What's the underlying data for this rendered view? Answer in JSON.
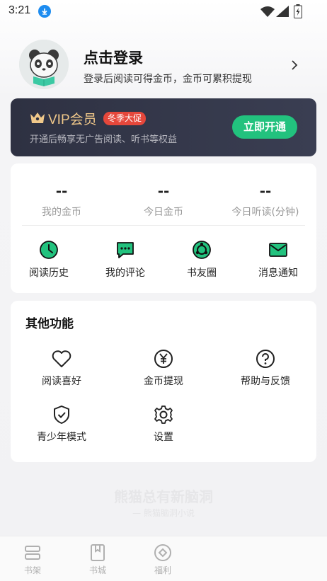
{
  "status_bar": {
    "time": "3:21"
  },
  "profile": {
    "title": "点击登录",
    "subtitle": "登录后阅读可得金币，金币可累积提现"
  },
  "vip": {
    "title": "VIP会员",
    "badge": "冬季大促",
    "description": "开通后畅享无广告阅读、听书等权益",
    "button": "立即开通",
    "accent_color": "#22c27e"
  },
  "stats": [
    {
      "value": "--",
      "label": "我的金币"
    },
    {
      "value": "--",
      "label": "今日金币"
    },
    {
      "value": "--",
      "label": "今日听读(分钟)"
    }
  ],
  "quick_actions": [
    {
      "icon": "clock-icon",
      "label": "阅读历史"
    },
    {
      "icon": "comment-icon",
      "label": "我的评论"
    },
    {
      "icon": "circle-ring-icon",
      "label": "书友圈"
    },
    {
      "icon": "mail-icon",
      "label": "消息通知"
    }
  ],
  "other": {
    "title": "其他功能",
    "items": [
      {
        "icon": "heart-icon",
        "label": "阅读喜好"
      },
      {
        "icon": "yen-coin-icon",
        "label": "金币提现"
      },
      {
        "icon": "question-icon",
        "label": "帮助与反馈"
      },
      {
        "icon": "shield-check-icon",
        "label": "青少年模式"
      },
      {
        "icon": "gear-icon",
        "label": "设置"
      }
    ]
  },
  "watermark": {
    "main": "熊猫总有新脑洞",
    "sub": "— 熊猫脑洞小说"
  },
  "bottom_nav": [
    {
      "icon": "bookshelf-icon",
      "label": "书架"
    },
    {
      "icon": "book-store-icon",
      "label": "书城"
    },
    {
      "icon": "welfare-icon",
      "label": "福利"
    }
  ]
}
